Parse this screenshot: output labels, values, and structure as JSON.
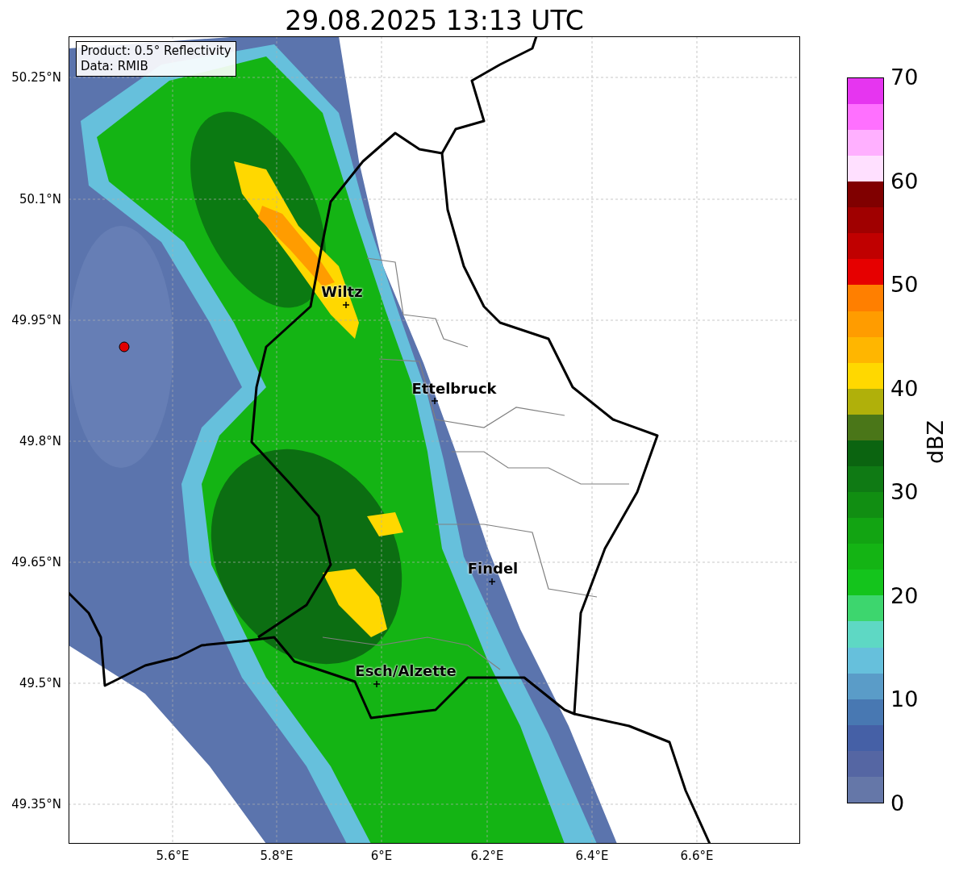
{
  "title": "29.08.2025 13:13 UTC",
  "legend": [
    "Product: 0.5° Reflectivity",
    "Data: RMIB"
  ],
  "cities": [
    {
      "name": "Wiltz"
    },
    {
      "name": "Ettelbruck"
    },
    {
      "name": "Findel"
    },
    {
      "name": "Esch/Alzette"
    }
  ],
  "y_ticks": [
    "50.25°N",
    "50.1°N",
    "49.95°N",
    "49.8°N",
    "49.65°N",
    "49.5°N",
    "49.35°N"
  ],
  "x_ticks": [
    "5.6°E",
    "5.8°E",
    "6°E",
    "6.2°E",
    "6.4°E",
    "6.6°E"
  ],
  "colorbar": {
    "label": "dBZ",
    "ticks": [
      "70",
      "60",
      "50",
      "40",
      "30",
      "20",
      "10",
      "0"
    ]
  }
}
